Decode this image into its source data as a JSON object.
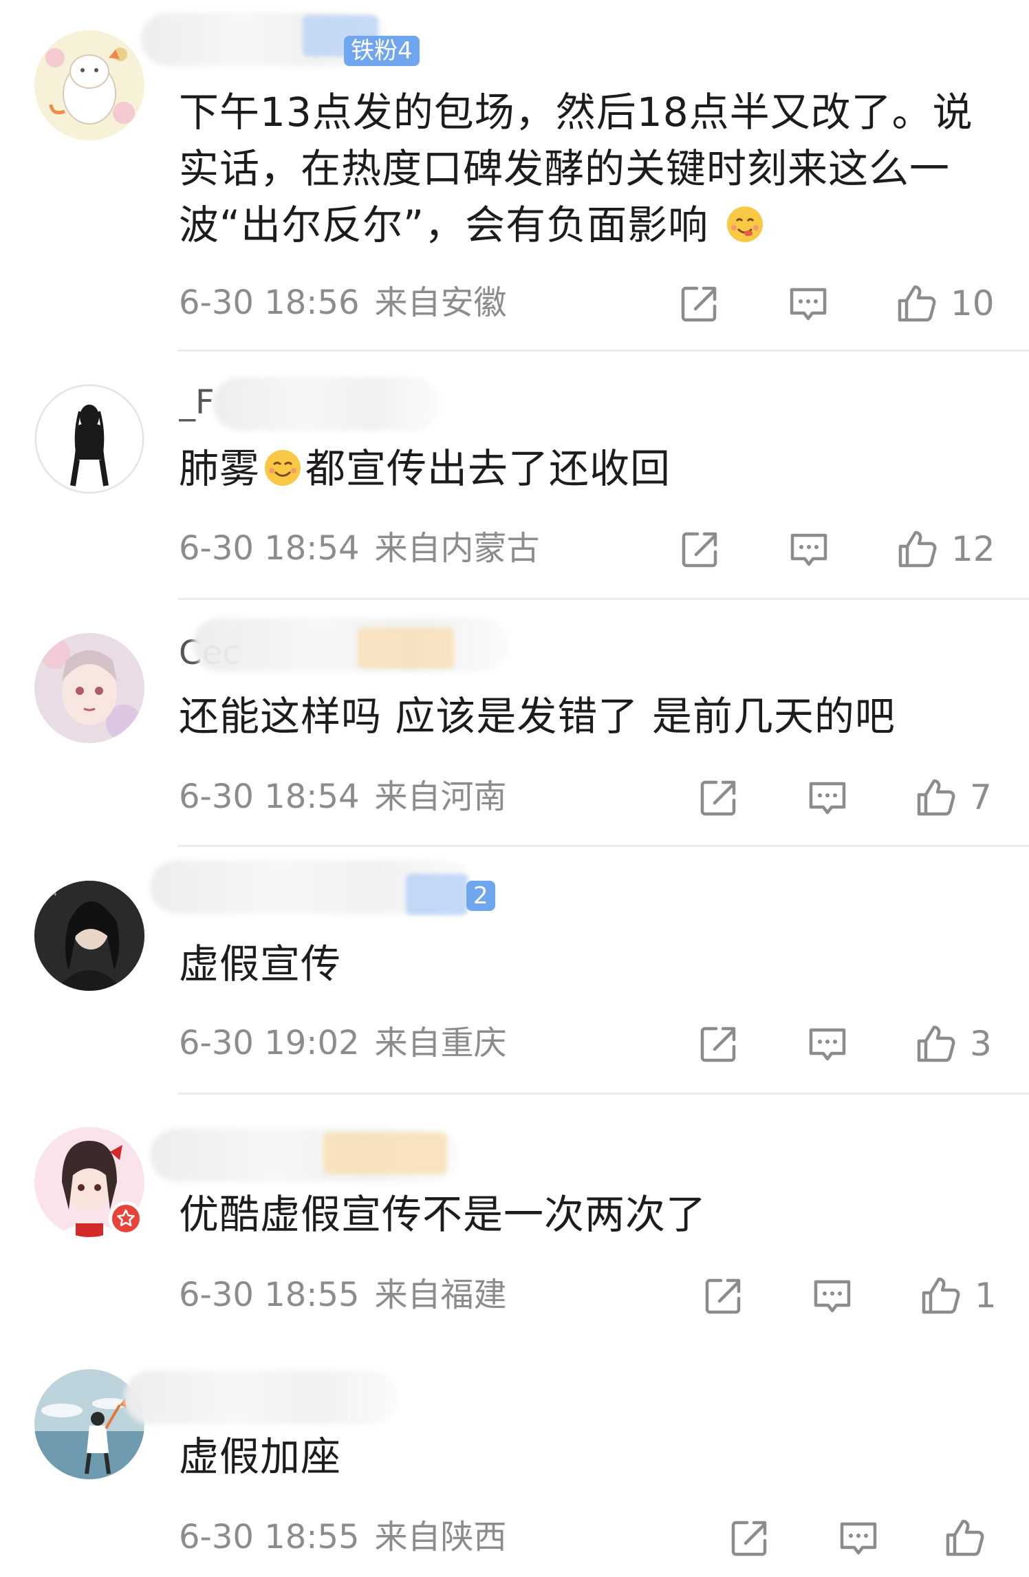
{
  "comments": [
    {
      "username": "",
      "level_badge": "铁粉4",
      "content_parts": [
        "下午13点发的包场，然后18点半又改了。说实话，在热度口碑发酵的关键时刻来这么一波“出尔反尔”，会有负面影响"
      ],
      "content_emoji": "yummy-face-emoji",
      "date": "6-30 18:56",
      "location": "来自安徽",
      "likes": "10"
    },
    {
      "username": "_F",
      "content_before_emoji": "肺雾",
      "content_emoji": "smile-emoji",
      "content_after_emoji": "都宣传出去了还收回",
      "date": "6-30 18:54",
      "location": "来自内蒙古",
      "likes": "12"
    },
    {
      "username": "Cec",
      "content": "还能这样吗 应该是发错了 是前几天的吧",
      "date": "6-30 18:54",
      "location": "来自河南",
      "likes": "7"
    },
    {
      "username": "",
      "level_badge": "2",
      "content": "虚假宣传",
      "date": "6-30 19:02",
      "location": "来自重庆",
      "likes": "3"
    },
    {
      "username": "",
      "content": "优酷虚假宣传不是一次两次了",
      "date": "6-30 18:55",
      "location": "来自福建",
      "likes": "1"
    },
    {
      "username": "",
      "content": "虚假加座",
      "date": "6-30 18:55",
      "location": "来自陕西",
      "likes": ""
    }
  ],
  "icons": {
    "share": "share-icon",
    "reply": "comment-icon",
    "like": "thumbs-up-icon"
  },
  "colors": {
    "meta_text": "#8c8c8c",
    "content_text": "#1c1c1c",
    "level_badge": "#6fa6ee",
    "divider": "#ececec",
    "badge_red": "#e8433a"
  }
}
